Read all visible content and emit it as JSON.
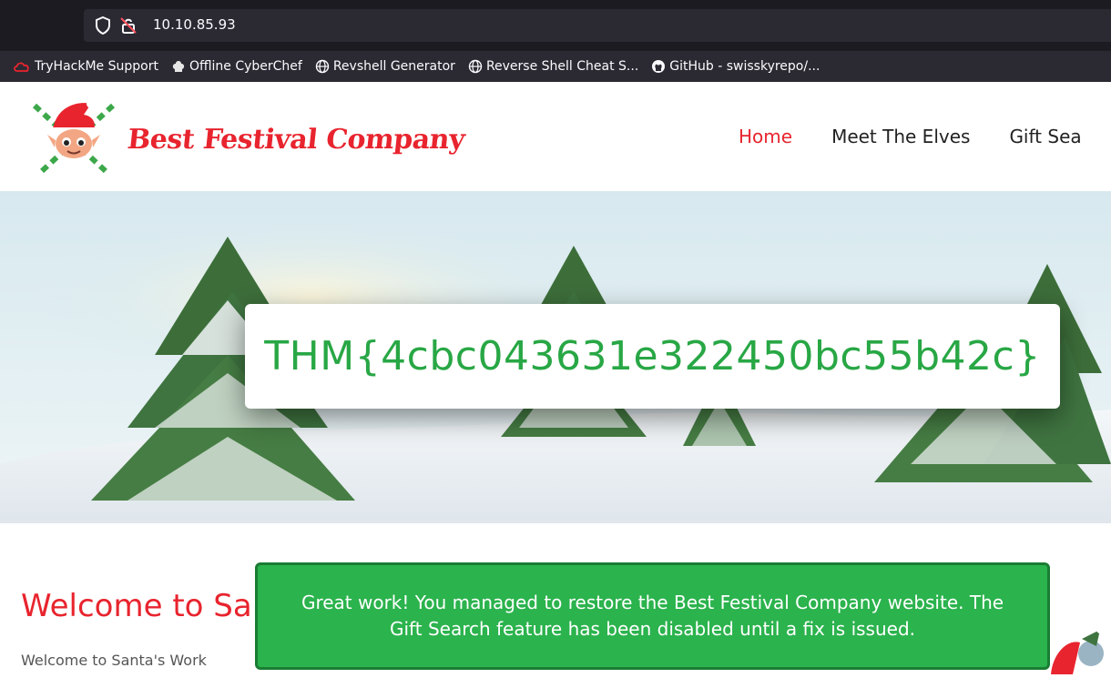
{
  "browser": {
    "url": "10.10.85.93",
    "bookmarks": [
      {
        "label": "TryHackMe Support",
        "icon": "cloud-icon"
      },
      {
        "label": "Offline CyberChef",
        "icon": "chef-hat-icon"
      },
      {
        "label": "Revshell Generator",
        "icon": "globe-icon"
      },
      {
        "label": "Reverse Shell Cheat S...",
        "icon": "globe-icon"
      },
      {
        "label": "GitHub - swisskyrepo/...",
        "icon": "github-icon"
      }
    ]
  },
  "site": {
    "brand": "Best Festival Company",
    "nav": [
      {
        "label": "Home",
        "active": true
      },
      {
        "label": "Meet The Elves",
        "active": false
      },
      {
        "label": "Gift Sea",
        "active": false
      }
    ]
  },
  "hero": {
    "flag": "THM{4cbc043631e322450bc55b42c}"
  },
  "content": {
    "welcome_title": "Welcome to Sa",
    "welcome_text": "Welcome to Santa's Work"
  },
  "toast": {
    "message": "Great work! You managed to restore the Best Festival Company website. The Gift Search feature has been disabled until a fix is issued."
  },
  "colors": {
    "brand_red": "#e8242e",
    "flag_green": "#28a745",
    "toast_green": "#2bb34d"
  }
}
